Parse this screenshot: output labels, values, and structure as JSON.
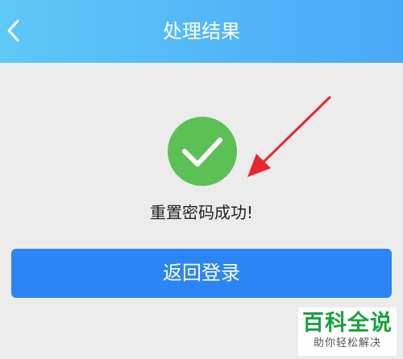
{
  "header": {
    "title": "处理结果",
    "back_icon": "chevron-left-icon",
    "background_start": "#5ec8f7",
    "background_end": "#4aa8f8"
  },
  "result": {
    "icon": "check-circle-icon",
    "icon_color": "#5cc154",
    "message": "重置密码成功!"
  },
  "actions": {
    "login_label": "返回登录",
    "button_color": "#2b85f5"
  },
  "watermark": {
    "title": "百科全说",
    "subtitle": "助你轻松解决"
  },
  "annotation": {
    "icon": "red-arrow-icon",
    "color": "#e8262d"
  }
}
